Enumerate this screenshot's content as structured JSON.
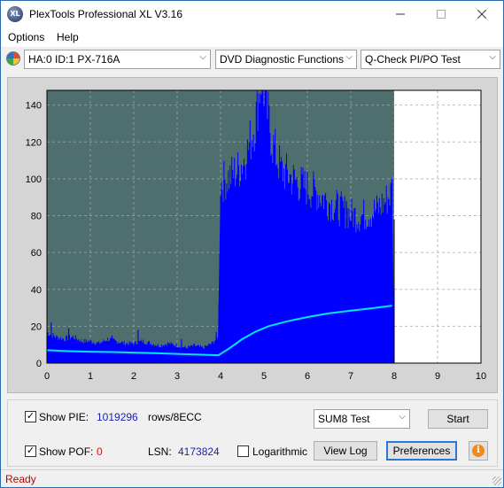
{
  "window": {
    "title": "PlexTools Professional XL V3.16",
    "app_icon_text": "XL"
  },
  "menu": {
    "items": [
      "Options",
      "Help"
    ]
  },
  "toolbar": {
    "drive": "HA:0 ID:1  PX-716A",
    "function": "DVD Diagnostic Functions",
    "test": "Q-Check PI/PO Test"
  },
  "chart_data": {
    "type": "area",
    "x_ticks": [
      "0",
      "1",
      "2",
      "3",
      "4",
      "5",
      "6",
      "7",
      "8",
      "9",
      "10"
    ],
    "y_ticks": [
      "0",
      "20",
      "40",
      "60",
      "80",
      "100",
      "120",
      "140"
    ],
    "xlim": [
      0,
      10
    ],
    "ylim": [
      0,
      148
    ],
    "grid": true,
    "plot_background": "#4f6f6f",
    "series": [
      {
        "style": "filled-bars",
        "color": "#0000ff",
        "points": [
          [
            0.0,
            14
          ],
          [
            0.2,
            12
          ],
          [
            0.4,
            11
          ],
          [
            0.6,
            12
          ],
          [
            0.8,
            10
          ],
          [
            1.0,
            10
          ],
          [
            1.2,
            9
          ],
          [
            1.4,
            11
          ],
          [
            1.6,
            10
          ],
          [
            1.8,
            9
          ],
          [
            2.0,
            9
          ],
          [
            2.2,
            10
          ],
          [
            2.4,
            9
          ],
          [
            2.6,
            8
          ],
          [
            2.8,
            9
          ],
          [
            3.0,
            8
          ],
          [
            3.2,
            7
          ],
          [
            3.4,
            8
          ],
          [
            3.6,
            7
          ],
          [
            3.8,
            9
          ],
          [
            3.95,
            12
          ],
          [
            4.0,
            82
          ],
          [
            4.2,
            85
          ],
          [
            4.4,
            88
          ],
          [
            4.6,
            95
          ],
          [
            4.8,
            110
          ],
          [
            4.9,
            125
          ],
          [
            4.95,
            132
          ],
          [
            5.0,
            125
          ],
          [
            5.1,
            112
          ],
          [
            5.2,
            100
          ],
          [
            5.4,
            88
          ],
          [
            5.6,
            85
          ],
          [
            5.8,
            82
          ],
          [
            6.0,
            80
          ],
          [
            6.2,
            78
          ],
          [
            6.4,
            75
          ],
          [
            6.6,
            72
          ],
          [
            6.8,
            70
          ],
          [
            7.0,
            68
          ],
          [
            7.2,
            67
          ],
          [
            7.4,
            68
          ],
          [
            7.6,
            70
          ],
          [
            7.8,
            74
          ],
          [
            7.95,
            78
          ],
          [
            8.0,
            0
          ]
        ],
        "peaks": [
          [
            0.1,
            22
          ],
          [
            0.5,
            19
          ],
          [
            1.5,
            15
          ],
          [
            2.1,
            18
          ],
          [
            3.1,
            13
          ],
          [
            3.9,
            17
          ],
          [
            4.3,
            100
          ],
          [
            4.6,
            108
          ],
          [
            4.85,
            118
          ],
          [
            4.95,
            136
          ],
          [
            5.1,
            120
          ],
          [
            5.5,
            102
          ],
          [
            6.2,
            93
          ],
          [
            6.9,
            88
          ],
          [
            7.6,
            85
          ],
          [
            7.95,
            100
          ]
        ]
      },
      {
        "style": "line",
        "color": "#00e5ff",
        "points": [
          [
            0.0,
            7
          ],
          [
            0.5,
            6.5
          ],
          [
            1.0,
            6.2
          ],
          [
            1.5,
            6
          ],
          [
            2.0,
            5.7
          ],
          [
            2.5,
            5.4
          ],
          [
            3.0,
            5
          ],
          [
            3.5,
            4.6
          ],
          [
            3.95,
            4.3
          ],
          [
            4.2,
            8
          ],
          [
            4.5,
            13
          ],
          [
            4.8,
            17
          ],
          [
            5.1,
            20
          ],
          [
            5.5,
            22.5
          ],
          [
            6.0,
            25
          ],
          [
            6.5,
            27
          ],
          [
            7.0,
            28.5
          ],
          [
            7.5,
            29.8
          ],
          [
            7.95,
            31.2
          ]
        ]
      }
    ]
  },
  "controls": {
    "show_pie_label": "Show PIE:",
    "show_pie_checked": true,
    "pie_value": "1019296",
    "pie_unit": "rows/8ECC",
    "show_pof_label": "Show POF:",
    "show_pof_checked": true,
    "pof_value": "0",
    "lsn_label": "LSN:",
    "lsn_value": "4173824",
    "logarithmic_label": "Logarithmic",
    "logarithmic_checked": false,
    "test_mode": "SUM8 Test",
    "start_label": "Start",
    "view_log_label": "View Log",
    "preferences_label": "Preferences",
    "info_icon_text": "i"
  },
  "status": {
    "text": "Ready"
  }
}
